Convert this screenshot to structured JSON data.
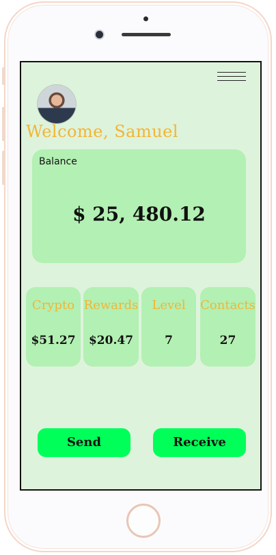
{
  "header": {
    "menu_icon": "hamburger-menu-icon",
    "welcome_text": "Welcome, Samuel"
  },
  "balance": {
    "label": "Balance",
    "value": "$ 25, 480.12"
  },
  "stats": [
    {
      "title": "Crypto",
      "value": "$51.27"
    },
    {
      "title": "Rewards",
      "value": "$20.47"
    },
    {
      "title": "Level",
      "value": "7"
    },
    {
      "title": "Contacts",
      "value": "27"
    }
  ],
  "actions": {
    "send_label": "Send",
    "receive_label": "Receive"
  },
  "colors": {
    "screen_bg": "#def3dc",
    "card_bg": "#b3f0b3",
    "accent_text": "#f2b533",
    "button_bg": "#00ff59"
  }
}
